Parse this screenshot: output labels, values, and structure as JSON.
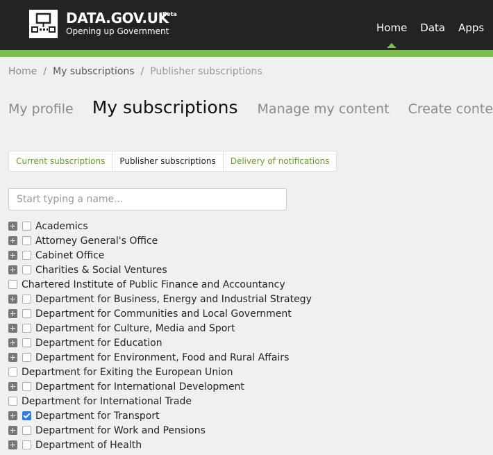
{
  "header": {
    "title": "DATA.GOV.UK",
    "beta": "Beta",
    "subtitle": "Opening up Government",
    "nav": [
      {
        "label": "Home",
        "active": true
      },
      {
        "label": "Data",
        "active": false
      },
      {
        "label": "Apps",
        "active": false
      }
    ],
    "accent": "#7cbf4a"
  },
  "breadcrumb": {
    "home": "Home",
    "mid": "My subscriptions",
    "current": "Publisher subscriptions"
  },
  "page_tabs": [
    {
      "label": "My profile",
      "active": false
    },
    {
      "label": "My subscriptions",
      "active": true
    },
    {
      "label": "Manage my content",
      "active": false
    },
    {
      "label": "Create content",
      "active": false
    }
  ],
  "sub_tabs": [
    {
      "label": "Current subscriptions",
      "active": false
    },
    {
      "label": "Publisher subscriptions",
      "active": true
    },
    {
      "label": "Delivery of notifications",
      "active": false
    }
  ],
  "search": {
    "placeholder": "Start typing a name...",
    "value": ""
  },
  "publishers": [
    {
      "name": "Academics",
      "expandable": true,
      "checked": false
    },
    {
      "name": "Attorney General's Office",
      "expandable": true,
      "checked": false
    },
    {
      "name": "Cabinet Office",
      "expandable": true,
      "checked": false
    },
    {
      "name": "Charities & Social Ventures",
      "expandable": true,
      "checked": false
    },
    {
      "name": "Chartered Institute of Public Finance and Accountancy",
      "expandable": false,
      "checked": false
    },
    {
      "name": "Department for Business, Energy and Industrial Strategy",
      "expandable": true,
      "checked": false
    },
    {
      "name": "Department for Communities and Local Government",
      "expandable": true,
      "checked": false
    },
    {
      "name": "Department for Culture, Media and Sport",
      "expandable": true,
      "checked": false
    },
    {
      "name": "Department for Education",
      "expandable": true,
      "checked": false
    },
    {
      "name": "Department for Environment, Food and Rural Affairs",
      "expandable": true,
      "checked": false
    },
    {
      "name": "Department for Exiting the European Union",
      "expandable": false,
      "checked": false
    },
    {
      "name": "Department for International Development",
      "expandable": true,
      "checked": false
    },
    {
      "name": "Department for International Trade",
      "expandable": false,
      "checked": false
    },
    {
      "name": "Department for Transport",
      "expandable": true,
      "checked": true
    },
    {
      "name": "Department for Work and Pensions",
      "expandable": true,
      "checked": false
    },
    {
      "name": "Department of Health",
      "expandable": true,
      "checked": false
    }
  ]
}
